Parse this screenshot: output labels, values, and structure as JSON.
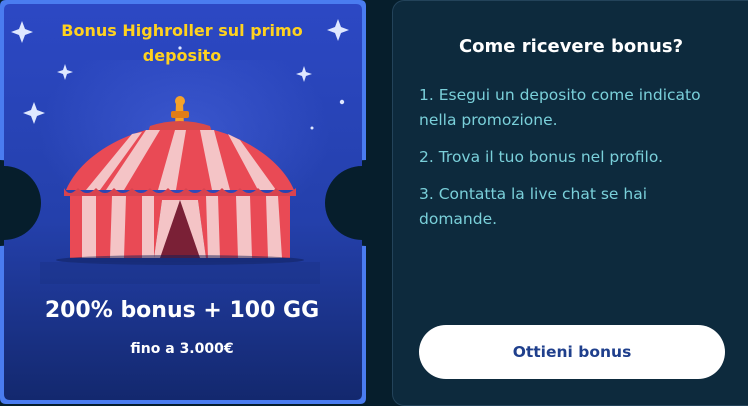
{
  "promo": {
    "title": "Bonus Highroller sul primo deposito",
    "offer": "200% bonus + 100 GG",
    "cap": "fino a 3.000€",
    "image": "circus-tent-illustration"
  },
  "how_to": {
    "title": "Come ricevere bonus?",
    "steps": [
      "1. Esegui un deposito come indicato nella promozione.",
      "2. Trova il tuo bonus nel profilo.",
      "3. Contatta la live chat se hai domande."
    ],
    "cta_label": "Ottieni bonus"
  },
  "colors": {
    "card_top": "#2c48c4",
    "card_bottom": "#13286e",
    "card_border": "#4a7cf0",
    "title_yellow": "#ffd21f",
    "panel_bg": "#0d2a3d",
    "step_text": "#7ad0da",
    "button_text": "#1f3f8c"
  }
}
